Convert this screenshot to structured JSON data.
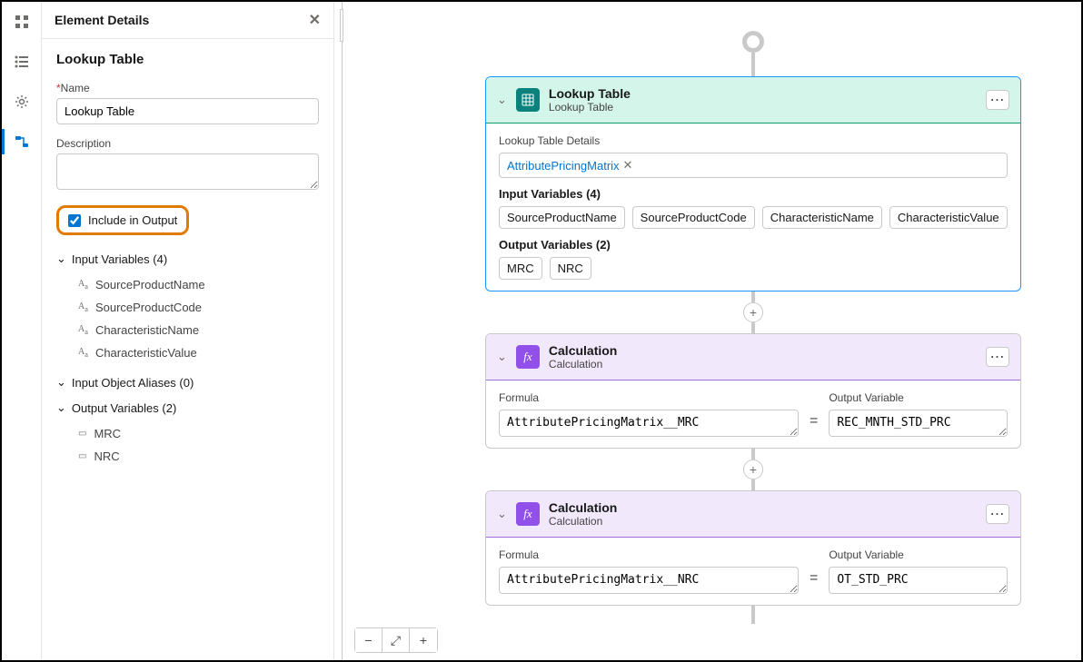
{
  "panel": {
    "header": "Element Details",
    "title": "Lookup Table",
    "nameLabel": "Name",
    "nameValue": "Lookup Table",
    "descLabel": "Description",
    "descValue": "",
    "includeInOutputLabel": "Include in Output",
    "inputVarsHeader": "Input Variables (4)",
    "inputVars": [
      "SourceProductName",
      "SourceProductCode",
      "CharacteristicName",
      "CharacteristicValue"
    ],
    "inputAliasesHeader": "Input Object Aliases (0)",
    "outputVarsHeader": "Output Variables (2)",
    "outputVars": [
      "MRC",
      "NRC"
    ]
  },
  "canvas": {
    "lookup": {
      "title": "Lookup Table",
      "subtitle": "Lookup Table",
      "detailsLabel": "Lookup Table Details",
      "detailsPill": "AttributePricingMatrix",
      "inputHeader": "Input Variables (4)",
      "inputChips": [
        "SourceProductName",
        "SourceProductCode",
        "CharacteristicName",
        "CharacteristicValue"
      ],
      "outputHeader": "Output Variables (2)",
      "outputChips": [
        "MRC",
        "NRC"
      ]
    },
    "calc1": {
      "title": "Calculation",
      "subtitle": "Calculation",
      "formulaLabel": "Formula",
      "formula": "AttributePricingMatrix__MRC",
      "outputLabel": "Output Variable",
      "output": "REC_MNTH_STD_PRC"
    },
    "calc2": {
      "title": "Calculation",
      "subtitle": "Calculation",
      "formulaLabel": "Formula",
      "formula": "AttributePricingMatrix__NRC",
      "outputLabel": "Output Variable",
      "output": "OT_STD_PRC"
    }
  }
}
